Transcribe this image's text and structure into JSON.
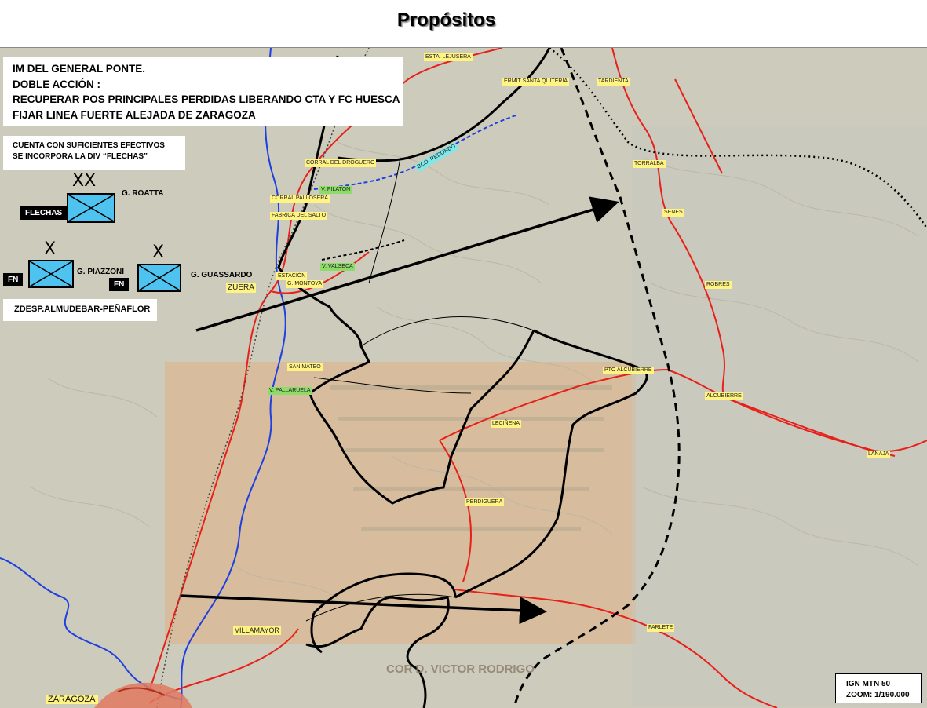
{
  "title": "Propósitos",
  "mission": {
    "lines": [
      "IM DEL GENERAL PONTE.",
      "DOBLE ACCIÓN :",
      "RECUPERAR POS PRINCIPALES PERDIDAS LIBERANDO CTA Y FC  HUESCA",
      "FIJAR LINEA FUERTE ALEJADA DE ZARAGOZA"
    ]
  },
  "forces_note": {
    "line1": "CUENTA CON SUFICIENTES EFECTIVOS",
    "line2": "SE INCORPORA LA DIV “FLECHAS”"
  },
  "units": {
    "flechas": {
      "tag": "FLECHAS",
      "commander": "G. ROATTA",
      "echelon": "XX"
    },
    "fn_left": {
      "tag": "FN",
      "commander": "G. PIAZZONI",
      "echelon": "X"
    },
    "fn_right": {
      "tag": "FN",
      "commander": "G. GUASSARDO",
      "echelon": "X"
    }
  },
  "detachment": "ZDESP.ALMUDEBAR-PEÑAFLOR",
  "scale_box": {
    "line1": "IGN MTN 50",
    "line2": "ZOOM: 1/190.000"
  },
  "credit": "COR D. VICTOR RODRIGO",
  "places": {
    "zuera": "ZUERA",
    "villamayor": "VILLAMAYOR",
    "zaragoza": "ZARAGOZA",
    "estacion": "ESTACIÓN",
    "montoya": "G. MONTOYA",
    "san_mateo": "SAN MATEO",
    "v_pallaruela": "V. PALLARUELA",
    "v_valseca": "V. VALSECA",
    "v_pilaton": "V. PILATON",
    "corral_droguero": "CORRAL DEL DROGUERO",
    "corral_losera": "CORRAL PALLOSERA",
    "fabrica_salto": "FABRICA DEL SALTO",
    "estacion_top": "ESTA. LEJUSERA",
    "ermita": "ERMIT SANTA QUITERIA",
    "tardienta": "TARDIENTA",
    "torralba": "TORRALBA",
    "senes": "SENES",
    "robres": "ROBRES",
    "pto_alcubierre": "PTO ALCUBIERRE",
    "alcubierre": "ALCUBIERRE",
    "leciñena": "LECIÑENA",
    "perdiguera": "PERDIGUERA",
    "lanaja": "LANAJA",
    "farlete": "FARLETE",
    "canal": "BCO. REDONDO"
  },
  "colors": {
    "road": "#e8201a",
    "river": "#1f3fe0",
    "unit_fill": "#4fc3f0",
    "terrain": "#cfcdbd",
    "overlay": "#d9b894"
  }
}
